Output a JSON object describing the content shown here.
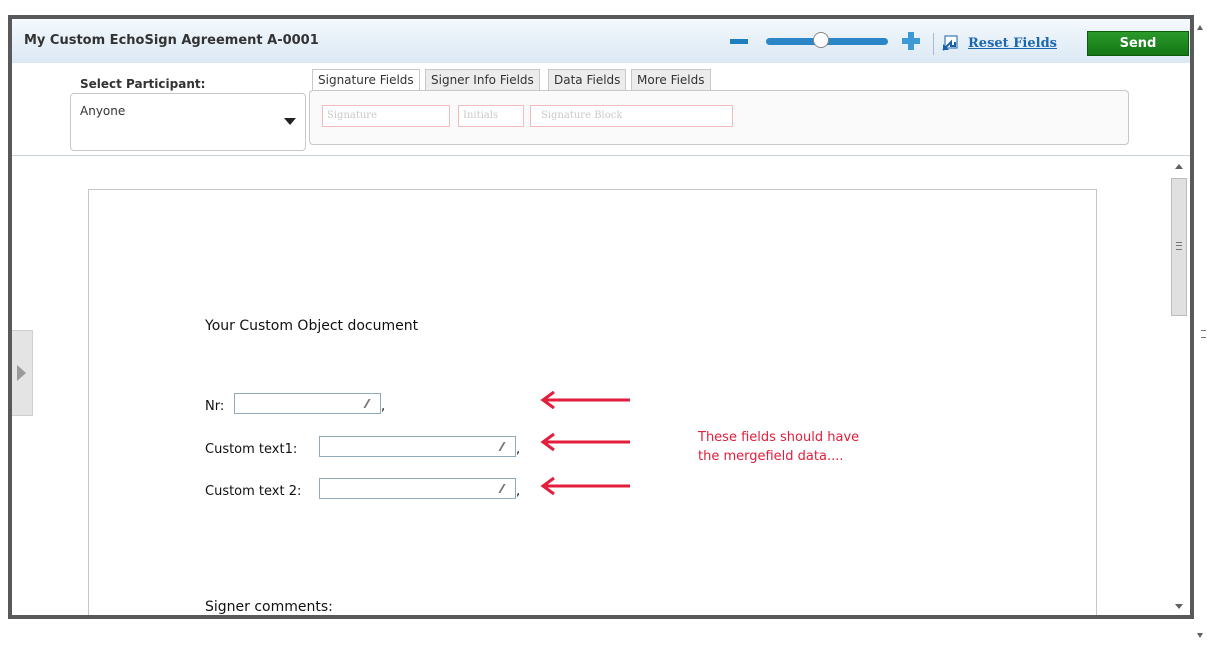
{
  "window": {
    "title": "My Custom EchoSign Agreement A-0001",
    "reset_label": "Reset Fields",
    "send_label": "Send"
  },
  "zoom": {
    "level_fraction": 0.45
  },
  "toolbar": {
    "participant_label": "Select Participant:",
    "participant_value": "Anyone",
    "tabs": [
      {
        "label": "Signature Fields",
        "active": true
      },
      {
        "label": "Signer Info Fields",
        "active": false
      },
      {
        "label": "Data Fields",
        "active": false
      },
      {
        "label": "More Fields",
        "active": false
      }
    ],
    "field_chips": [
      "Signature",
      "Initials",
      "Signature Block"
    ]
  },
  "document": {
    "title": "Your Custom Object document",
    "fields": [
      {
        "label": "Nr:"
      },
      {
        "label": "Custom text1:"
      },
      {
        "label": "Custom text 2:"
      }
    ],
    "comma": ",",
    "annotation_line1": "These fields should have",
    "annotation_line2": "the mergefield data....",
    "signer_comments_label": "Signer comments:"
  },
  "colors": {
    "annotation": "#e31d3b",
    "send_button": "#1a851a",
    "link": "#1a66b3",
    "frame_border": "#595959"
  },
  "icons": [
    "zoom-minus-icon",
    "zoom-plus-icon",
    "reset-fields-icon",
    "dropdown-arrow-icon",
    "resize-grip-icon",
    "red-arrow-icon",
    "collapse-panel-icon"
  ]
}
